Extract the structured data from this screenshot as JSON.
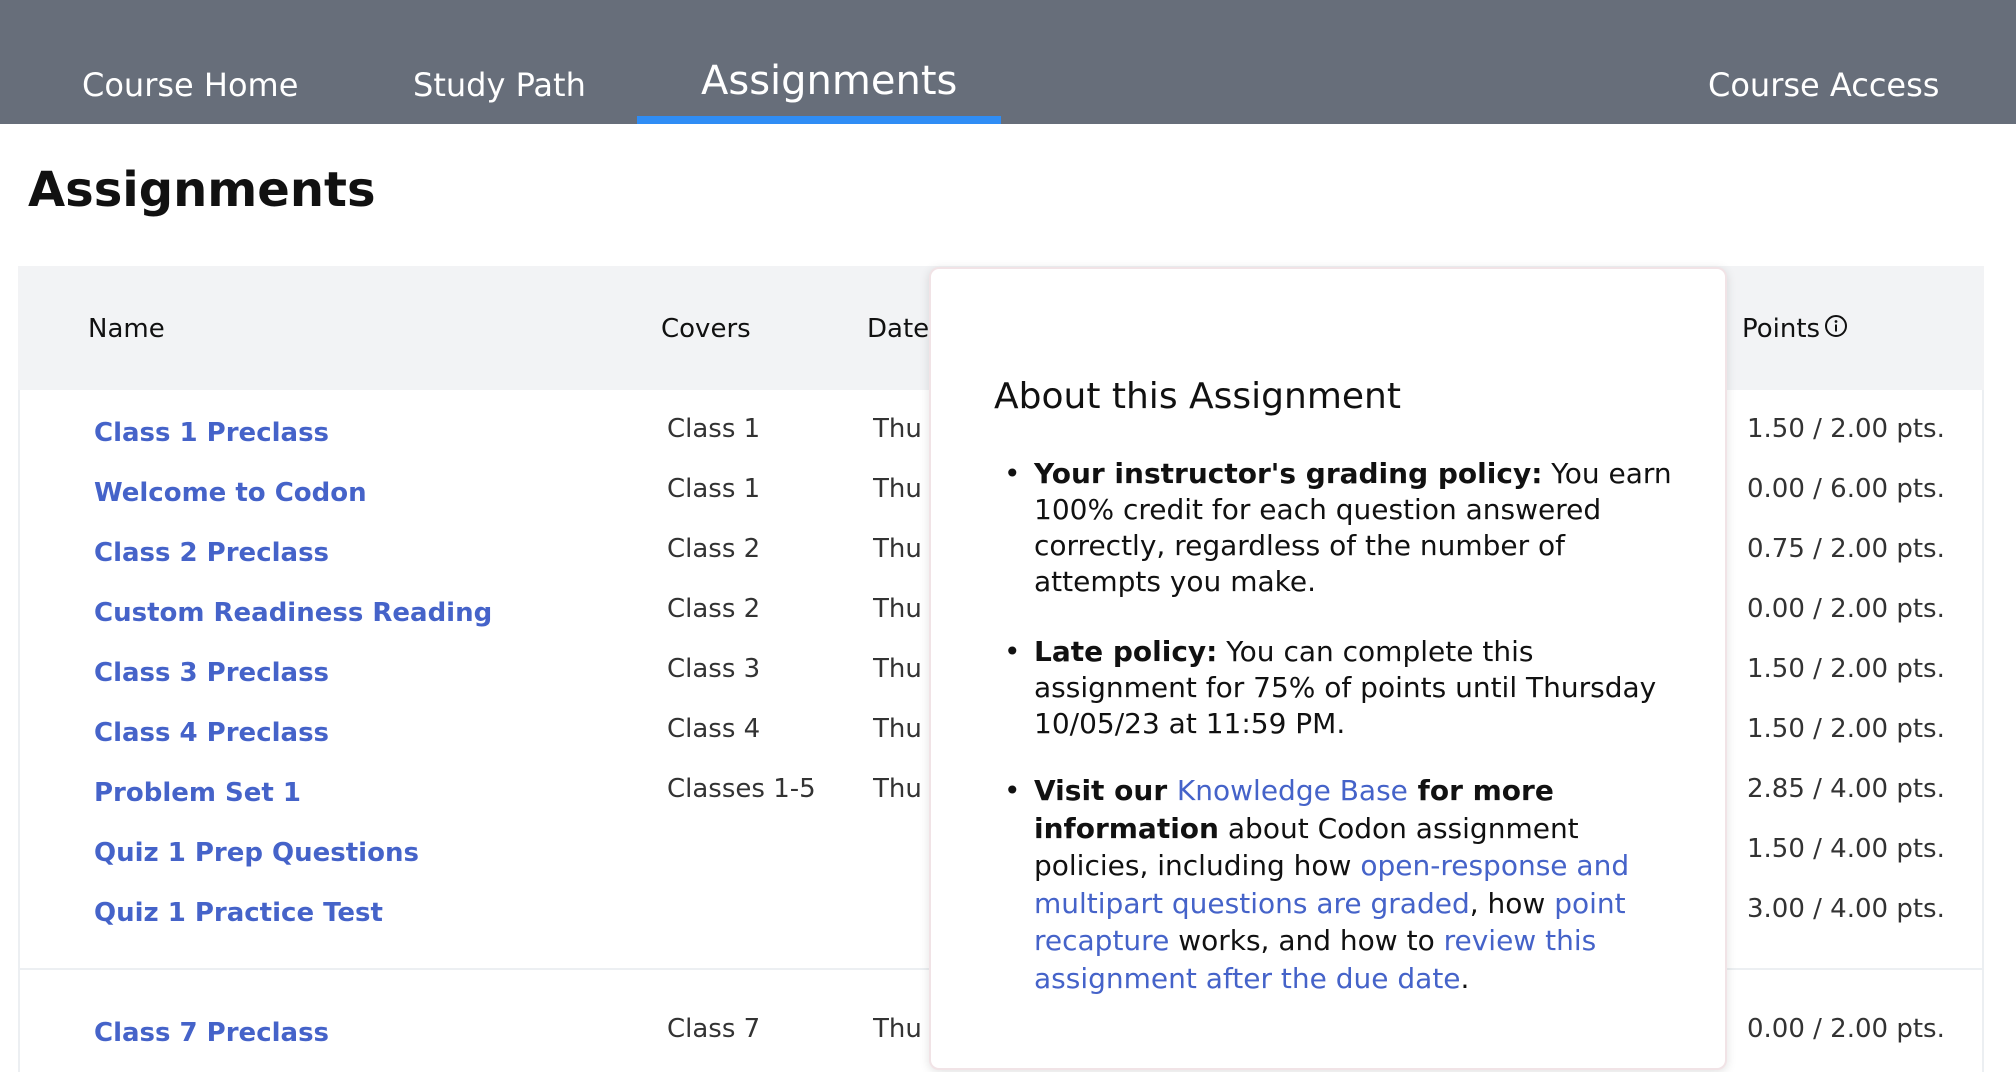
{
  "nav": {
    "tabs": [
      {
        "label": "Course Home"
      },
      {
        "label": "Study Path"
      },
      {
        "label": "Assignments"
      },
      {
        "label": "Course Access"
      }
    ],
    "active": "Assignments",
    "accent_color": "#2f8df5"
  },
  "page_title": "Assignments",
  "table": {
    "headers": {
      "name": "Name",
      "covers": "Covers",
      "date": "Date",
      "points": "Points"
    },
    "points_info_icon": "info-circle-icon",
    "rows": [
      {
        "name": "Class 1 Preclass",
        "covers": "Class 1",
        "date": "Thu",
        "points": "1.50 / 2.00 pts."
      },
      {
        "name": "Welcome to Codon",
        "covers": "Class 1",
        "date": "Thu",
        "points": "0.00 / 6.00 pts."
      },
      {
        "name": "Class 2 Preclass",
        "covers": "Class 2",
        "date": "Thu",
        "points": "0.75 / 2.00 pts."
      },
      {
        "name": "Custom Readiness Reading",
        "covers": "Class 2",
        "date": "Thu",
        "points": "0.00 / 2.00 pts."
      },
      {
        "name": "Class 3 Preclass",
        "covers": "Class 3",
        "date": "Thu",
        "points": "1.50 / 2.00 pts."
      },
      {
        "name": "Class 4 Preclass",
        "covers": "Class 4",
        "date": "Thu",
        "points": "1.50 / 2.00 pts."
      },
      {
        "name": "Problem Set 1",
        "covers": "Classes 1-5",
        "date": "Thu",
        "points": "2.85 / 4.00 pts."
      },
      {
        "name": "Quiz 1 Prep Questions",
        "covers": "",
        "date": "",
        "points": "1.50 / 4.00 pts."
      },
      {
        "name": "Quiz 1 Practice Test",
        "covers": "",
        "date": "",
        "points": "3.00 / 4.00 pts."
      },
      {
        "name": "Class 7 Preclass",
        "covers": "Class 7",
        "date": "Thu",
        "points": "0.00 / 2.00 pts."
      }
    ]
  },
  "popover": {
    "title": "About this Assignment",
    "grading": {
      "label": "Your instructor's grading policy:",
      "text": " You earn 100% credit for each question answered correctly, regardless of the number of attempts you make."
    },
    "late": {
      "label": "Late policy:",
      "text": " You can complete this assignment for 75% of points until Thursday 10/05/23 at 11:59 PM."
    },
    "visit": {
      "label_a": "Visit our ",
      "kb_link": "Knowledge Base",
      "label_b": " for more information",
      "text_a": " about Codon assignment policies, including how ",
      "link_graded": "open-response and multipart questions are graded",
      "text_b": ", how ",
      "link_recapture": "point recapture",
      "text_c": " works, and how to ",
      "link_review": "review this assignment after the due date",
      "text_d": "."
    }
  }
}
